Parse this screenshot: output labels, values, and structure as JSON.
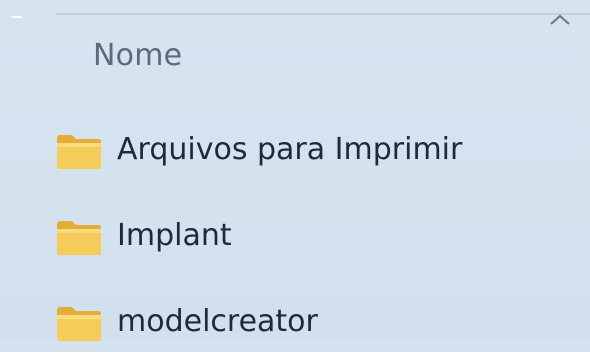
{
  "list": {
    "column_header": "Nome",
    "items": [
      {
        "name": "Arquivos para Imprimir",
        "icon": "folder-icon"
      },
      {
        "name": "Implant",
        "icon": "folder-icon"
      },
      {
        "name": "modelcreator",
        "icon": "folder-icon"
      }
    ]
  },
  "colors": {
    "background": "#d4e1ee",
    "header_text": "#5c6a7f",
    "item_text": "#1e2a3a",
    "folder_yellow": "#f5cc5a"
  }
}
